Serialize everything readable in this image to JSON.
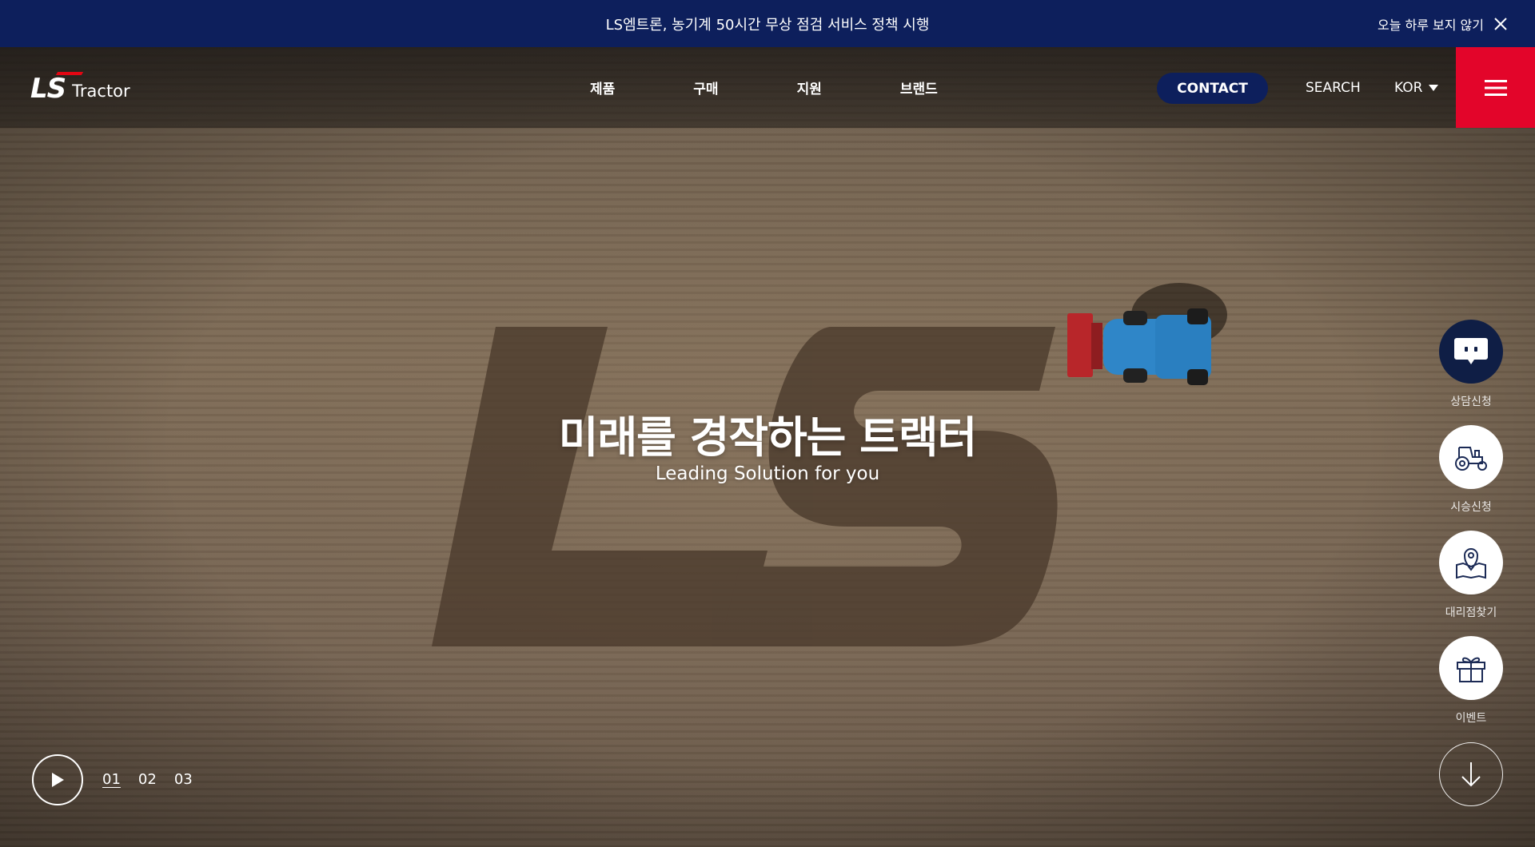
{
  "notice": {
    "text": "LS엠트론, 농기계 50시간 무상 점검 서비스 정책 시행",
    "dismiss_label": "오늘 하루 보지 않기"
  },
  "header": {
    "brand_ls": "LS",
    "brand_word": "Tractor",
    "nav": [
      "제품",
      "구매",
      "지원",
      "브랜드"
    ],
    "contact_label": "CONTACT",
    "search_label": "SEARCH",
    "language": "KOR"
  },
  "hero": {
    "title": "미래를 경작하는 트랙터",
    "subtitle": "Leading Solution for you"
  },
  "quick_menu": [
    {
      "label": "상담신청",
      "icon": "chat-icon"
    },
    {
      "label": "시승신청",
      "icon": "tractor-icon"
    },
    {
      "label": "대리점찾기",
      "icon": "map-pin-icon"
    },
    {
      "label": "이벤트",
      "icon": "gift-icon"
    }
  ],
  "slider": {
    "pages": [
      "01",
      "02",
      "03"
    ],
    "active_page": "01"
  },
  "colors": {
    "navy": "#0d1f5c",
    "brand_red": "#e3052a",
    "white": "#ffffff"
  }
}
